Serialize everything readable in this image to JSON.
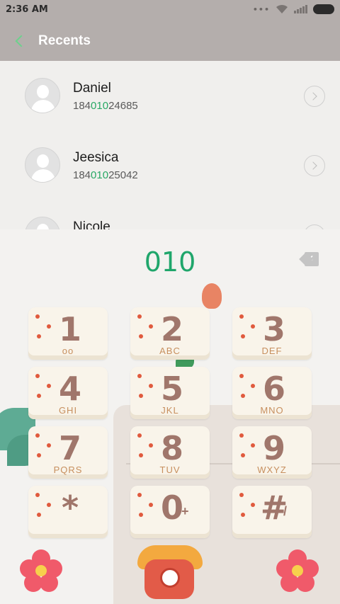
{
  "status_bar": {
    "time": "2:36 AM",
    "dots": "•••",
    "icons": [
      "wifi-icon",
      "signal-icon",
      "battery-icon"
    ]
  },
  "header": {
    "title": "Recents"
  },
  "recents": [
    {
      "name": "Daniel",
      "number_prefix": "184",
      "number_match": "010",
      "number_suffix": "24685"
    },
    {
      "name": "Jeesica",
      "number_prefix": "184",
      "number_match": "010",
      "number_suffix": "25042"
    },
    {
      "name": "Nicole",
      "number_prefix": "",
      "number_match": "",
      "number_suffix": ""
    }
  ],
  "dialer": {
    "input": "010",
    "keys": [
      {
        "digit": "1",
        "letters": "oo"
      },
      {
        "digit": "2",
        "letters": "ABC"
      },
      {
        "digit": "3",
        "letters": "DEF"
      },
      {
        "digit": "4",
        "letters": "GHI"
      },
      {
        "digit": "5",
        "letters": "JKL"
      },
      {
        "digit": "6",
        "letters": "MNO"
      },
      {
        "digit": "7",
        "letters": "PQRS"
      },
      {
        "digit": "8",
        "letters": "TUV"
      },
      {
        "digit": "9",
        "letters": "WXYZ"
      },
      {
        "digit": "*",
        "letters": ""
      },
      {
        "digit": "0",
        "letters": "+"
      },
      {
        "digit": "#",
        "letters": "/"
      }
    ]
  },
  "colors": {
    "header_bg": "#b4aeac",
    "accent_green": "#1fa66b",
    "key_digit": "#a0766b",
    "key_letters": "#c78f5e"
  }
}
